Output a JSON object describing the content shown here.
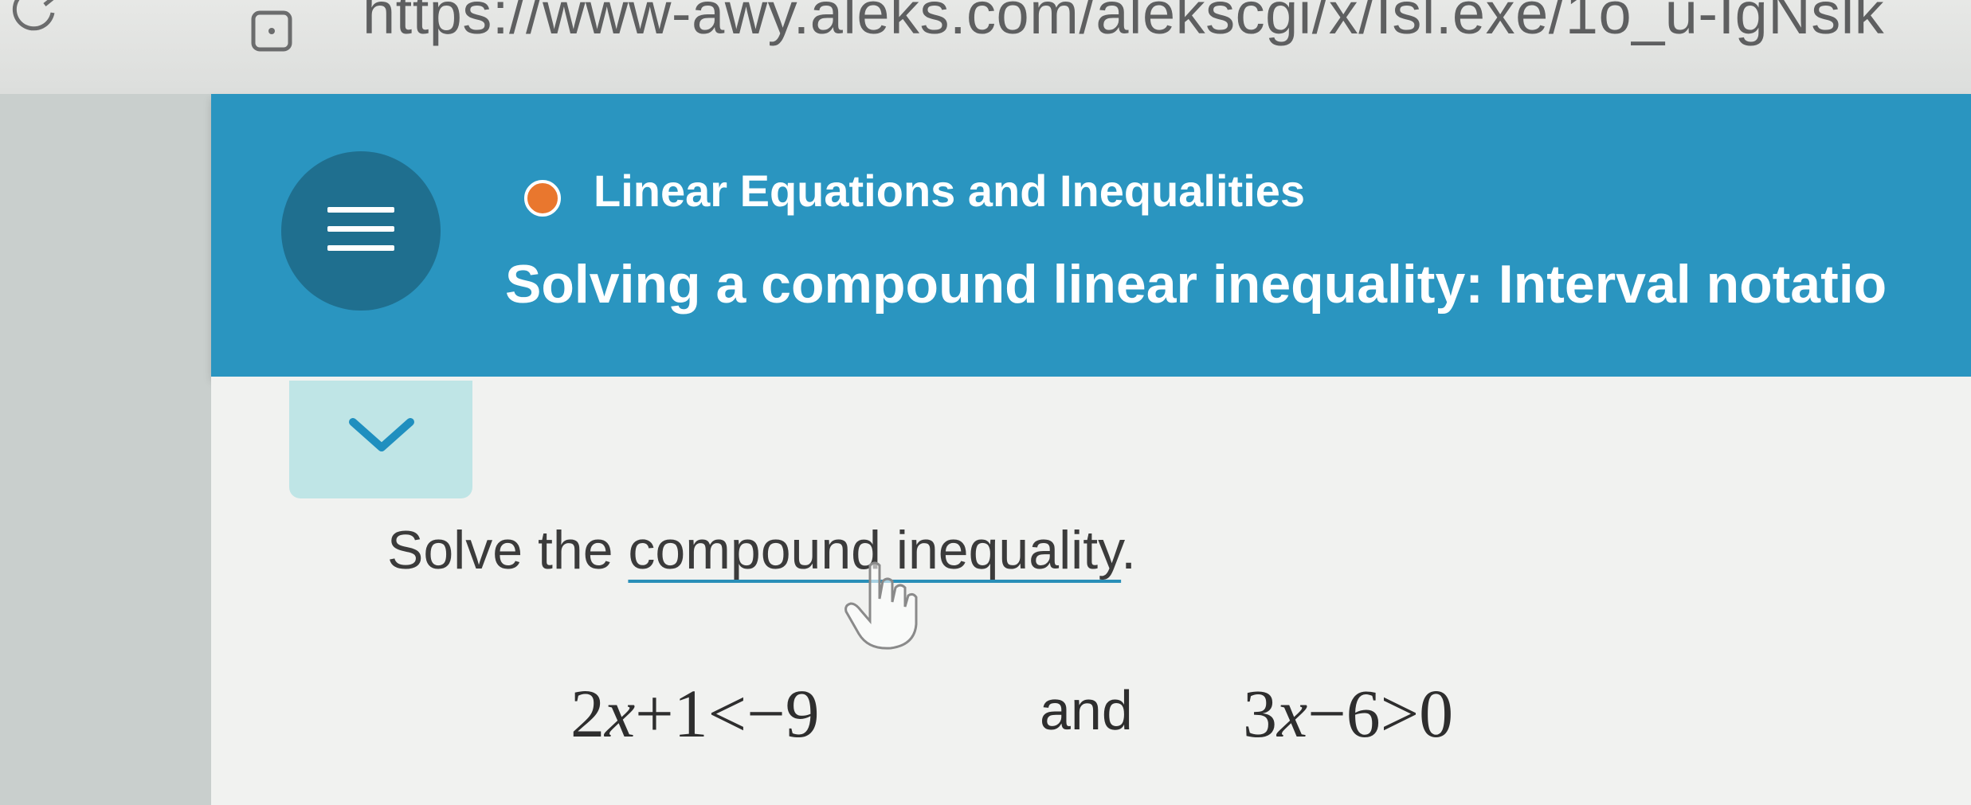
{
  "browser": {
    "url": "https://www-awy.aleks.com/alekscgi/x/Isl.exe/1o_u-IgNslk"
  },
  "header": {
    "topic": "Linear Equations and Inequalities",
    "lesson": "Solving a compound linear inequality: Interval notatio",
    "topic_dot_color": "#e9772e",
    "accent_color": "#2a95c0"
  },
  "problem": {
    "prompt_prefix": "Solve the ",
    "prompt_link": "compound inequality",
    "prompt_suffix": ".",
    "inequality_1": {
      "coef": "2",
      "variable": "x",
      "rest": "+1<−9"
    },
    "conjunction": "and",
    "inequality_2": {
      "coef": "3",
      "variable": "x",
      "rest": "−6>0"
    }
  }
}
